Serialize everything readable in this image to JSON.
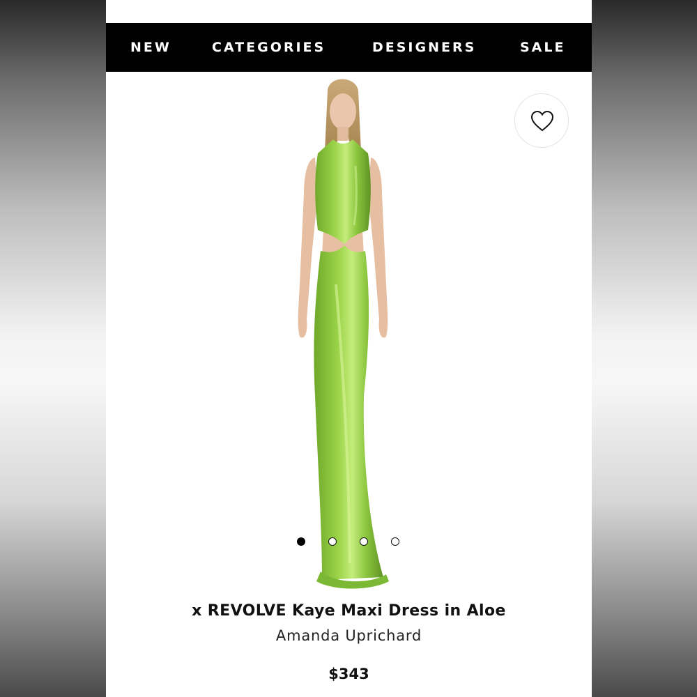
{
  "nav": {
    "items": [
      {
        "label": "NEW"
      },
      {
        "label": "CATEGORIES"
      },
      {
        "label": "DESIGNERS"
      },
      {
        "label": "SALE"
      }
    ]
  },
  "product": {
    "title": "x REVOLVE Kaye Maxi Dress in Aloe",
    "designer": "Amanda Uprichard",
    "price": "$343",
    "dress_color": "#8cc63f"
  },
  "carousel": {
    "total": 4,
    "active_index": 0
  },
  "icons": {
    "wishlist": "heart-icon"
  }
}
